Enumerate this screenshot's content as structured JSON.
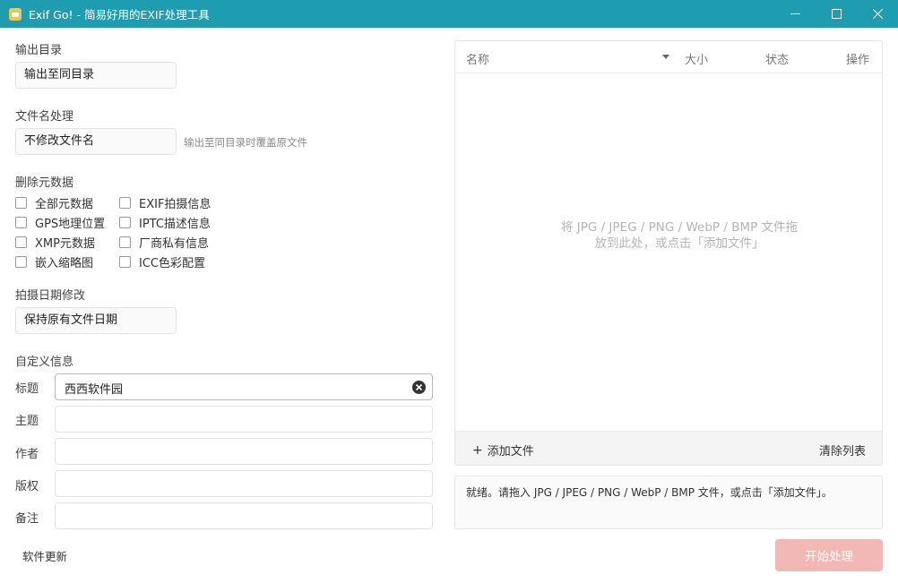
{
  "window": {
    "title": "Exif Go! - 简易好用的EXIF处理工具",
    "icon": "app-photo-icon",
    "controls": {
      "minimize": "minimize-icon",
      "maximize": "maximize-icon",
      "close": "close-icon"
    },
    "accent_color": "#1e9db0"
  },
  "output_dir": {
    "label": "输出目录",
    "value": "输出至同目录"
  },
  "filename": {
    "label": "文件名处理",
    "value": "不修改文件名",
    "hint": "输出至同目录时覆盖原文件"
  },
  "remove_meta": {
    "label": "删除元数据",
    "options": [
      {
        "label": "全部元数据",
        "checked": false
      },
      {
        "label": "EXIF拍摄信息",
        "checked": false
      },
      {
        "label": "GPS地理位置",
        "checked": false
      },
      {
        "label": "IPTC描述信息",
        "checked": false
      },
      {
        "label": "XMP元数据",
        "checked": false
      },
      {
        "label": "厂商私有信息",
        "checked": false
      },
      {
        "label": "嵌入缩略图",
        "checked": false
      },
      {
        "label": "ICC色彩配置",
        "checked": false
      }
    ]
  },
  "shoot_date": {
    "label": "拍摄日期修改",
    "value": "保持原有文件日期"
  },
  "custom_info": {
    "label": "自定义信息",
    "fields": [
      {
        "label": "标题",
        "value": "西西软件园"
      },
      {
        "label": "主题",
        "value": ""
      },
      {
        "label": "作者",
        "value": ""
      },
      {
        "label": "版权",
        "value": ""
      },
      {
        "label": "备注",
        "value": ""
      }
    ]
  },
  "update_link": "软件更新",
  "file_table": {
    "columns": {
      "name": "名称",
      "size": "大小",
      "status": "状态",
      "action": "操作"
    },
    "empty_line1": "将 JPG / JPEG / PNG / WebP / BMP 文件拖",
    "empty_line2": "放到此处，或点击「添加文件」",
    "add_label": "添加文件",
    "add_symbol": "+",
    "clear_label": "清除列表"
  },
  "status_text": "就绪。请拖入 JPG / JPEG / PNG / WebP / BMP 文件，或点击「添加文件」。",
  "start_button": {
    "label": "开始处理",
    "color": "#f2b8b3"
  }
}
